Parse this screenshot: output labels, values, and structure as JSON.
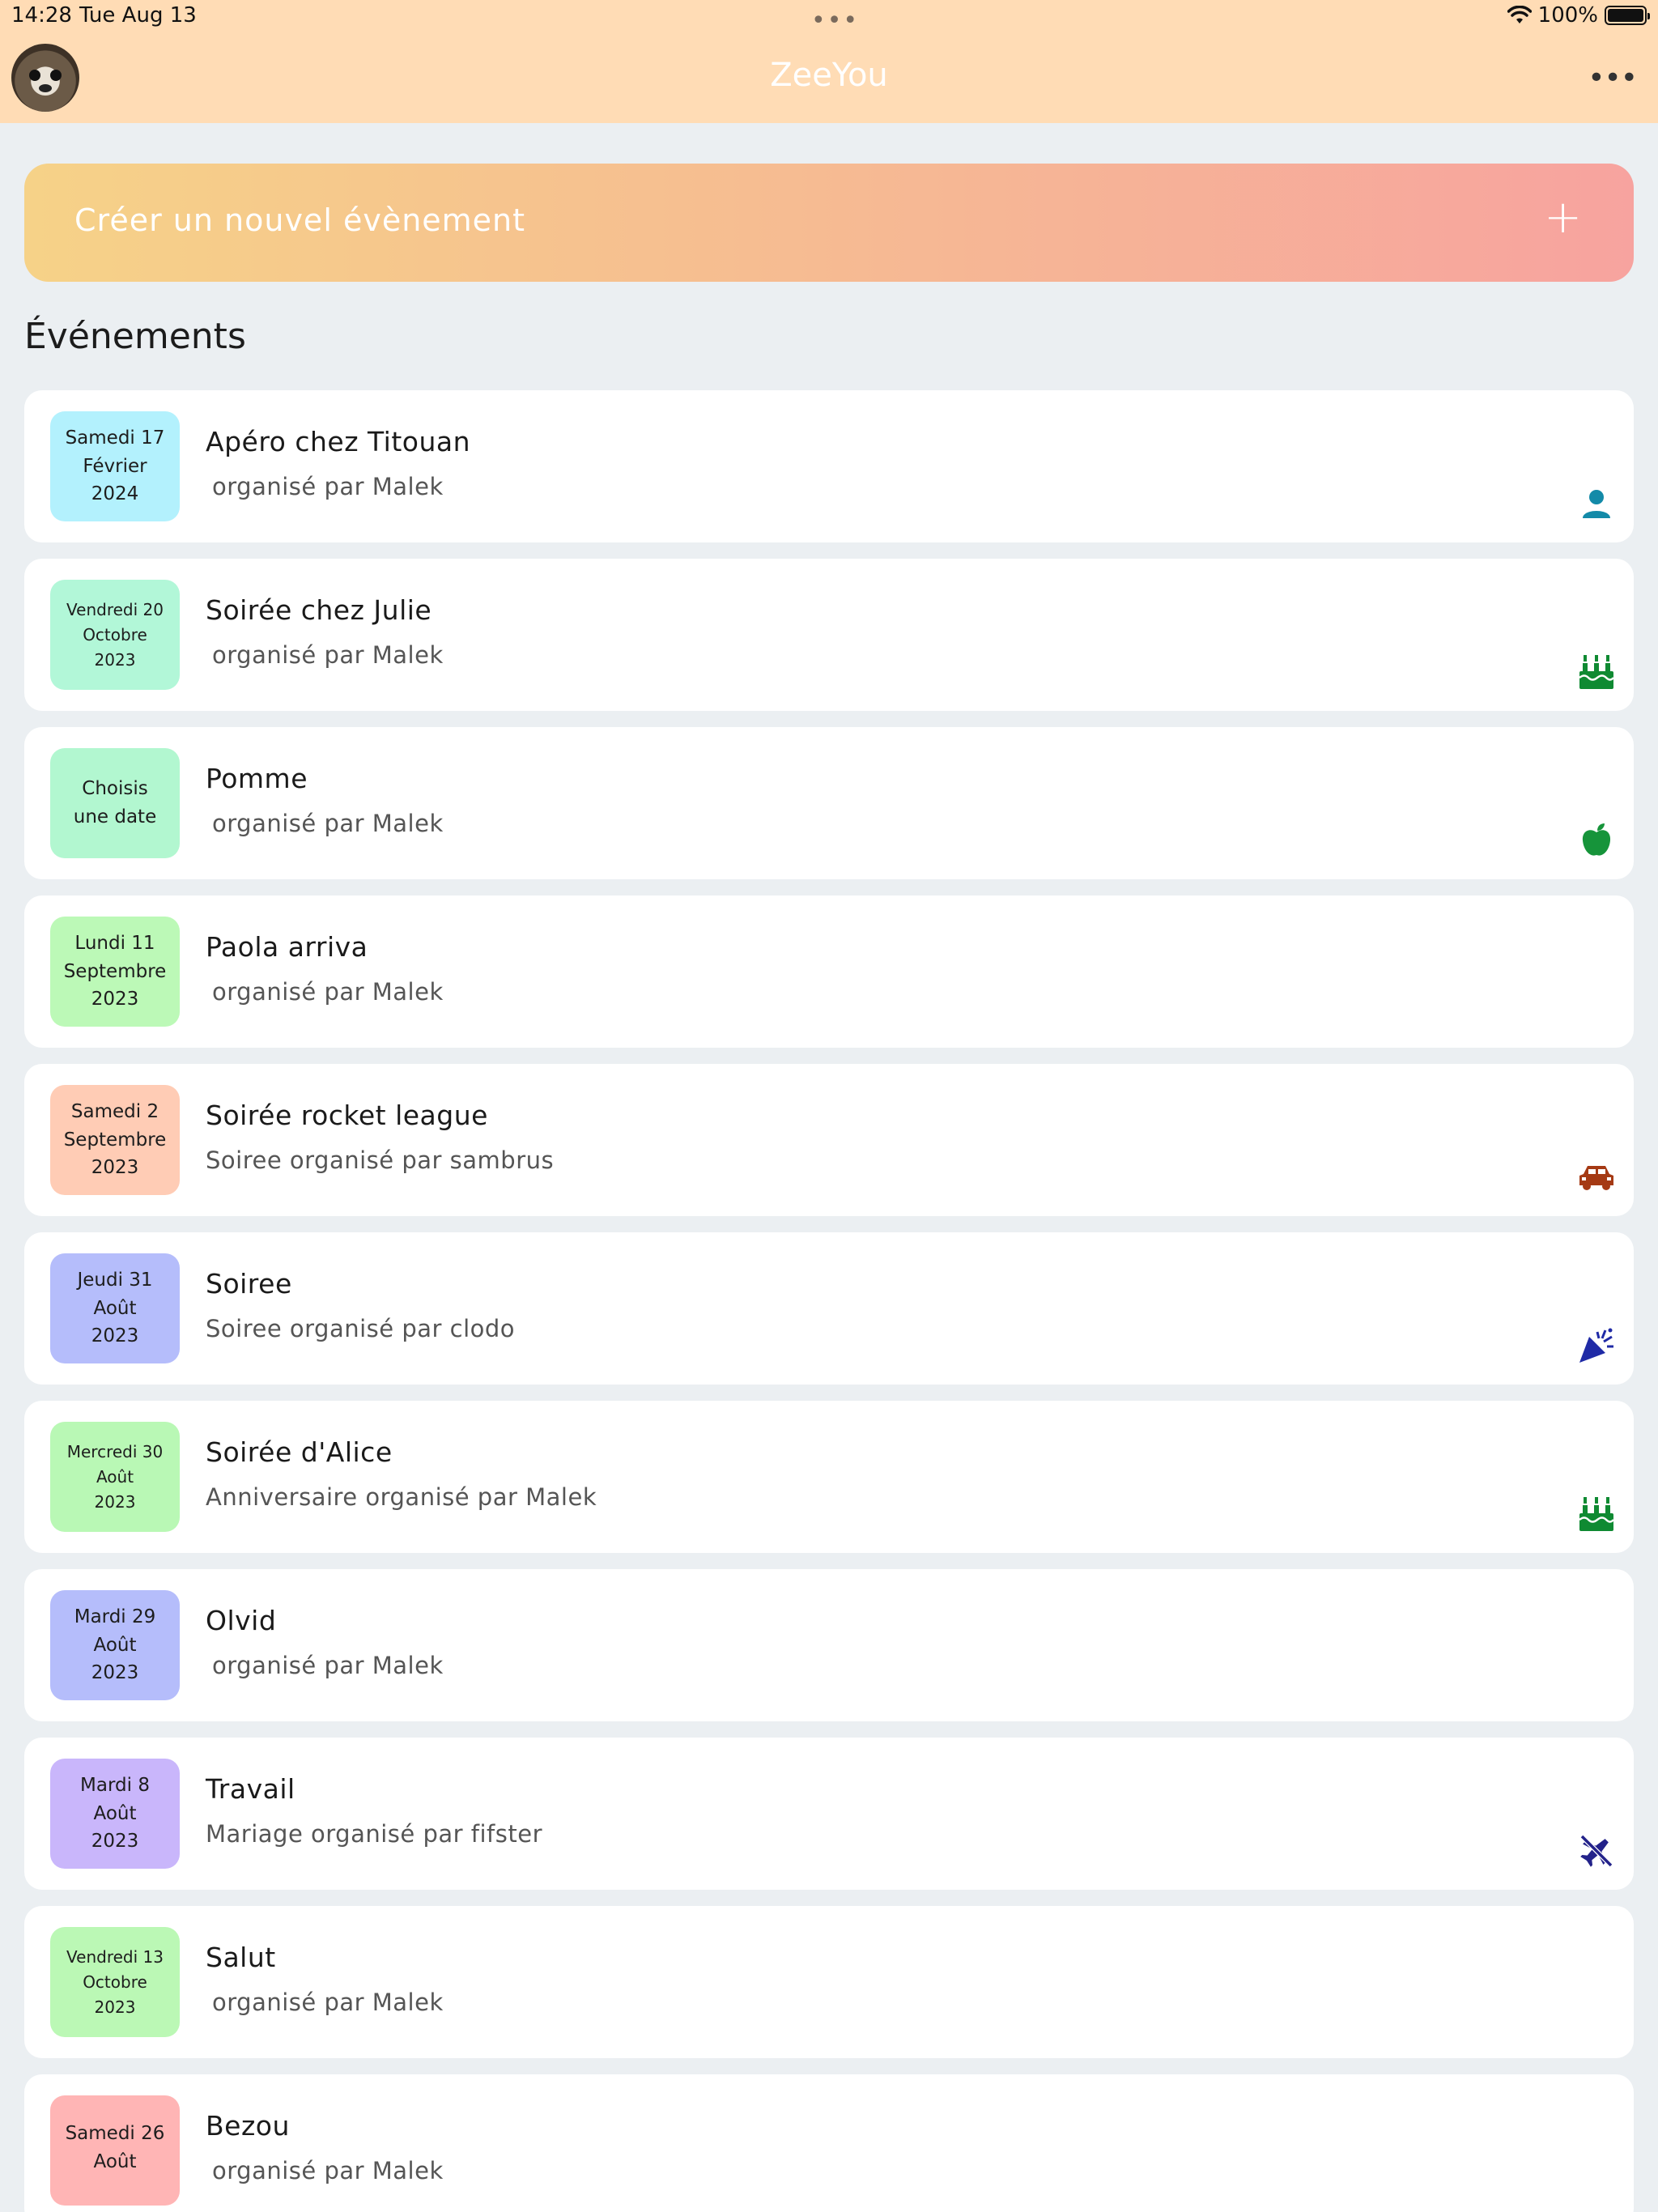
{
  "status_bar": {
    "time": "14:28",
    "date": "Tue Aug 13",
    "battery": "100%"
  },
  "header": {
    "title": "ZeeYou"
  },
  "create_button": {
    "label": "Créer un nouvel évènement",
    "icon": "+"
  },
  "section_title": "Événements",
  "events": [
    {
      "date_lines": [
        "Samedi 17",
        "Février",
        "2024"
      ],
      "date_color": "#b3f1fd",
      "title": "Apéro chez Titouan",
      "subtitle": "organisé par Malek",
      "icon": "person-icon",
      "icon_color": "#138aa8"
    },
    {
      "date_lines": [
        "Vendredi 20",
        "Octobre",
        "2023"
      ],
      "date_color": "#b2f7d8",
      "title": "Soirée chez Julie",
      "subtitle": "organisé par Malek",
      "icon": "cake-icon",
      "icon_color": "#0f8a32"
    },
    {
      "date_lines": [
        "Choisis",
        "une date"
      ],
      "date_color": "#b2f7d0",
      "title": "Pomme",
      "subtitle": "organisé par Malek",
      "icon": "apple-icon",
      "icon_color": "#16943a"
    },
    {
      "date_lines": [
        "Lundi 11",
        "Septembre",
        "2023"
      ],
      "date_color": "#bcf9b7",
      "title": "Paola arriva",
      "subtitle": "organisé par Malek",
      "icon": "",
      "icon_color": ""
    },
    {
      "date_lines": [
        "Samedi 2",
        "Septembre",
        "2023"
      ],
      "date_color": "#ffccb5",
      "title": "Soirée rocket league",
      "subtitle": "Soiree organisé par sambrus",
      "icon": "car-icon",
      "icon_color": "#a53a14"
    },
    {
      "date_lines": [
        "Jeudi 31",
        "Août",
        "2023"
      ],
      "date_color": "#b5bdfb",
      "title": "Soiree",
      "subtitle": "Soiree organisé par clodo",
      "icon": "party-popper-icon",
      "icon_color": "#1f2aa6"
    },
    {
      "date_lines": [
        "Mercredi 30",
        "Août",
        "2023"
      ],
      "date_color": "#b9f8b5",
      "title": "Soirée d'Alice",
      "subtitle": "Anniversaire organisé par Malek",
      "icon": "cake-icon",
      "icon_color": "#0f8a32"
    },
    {
      "date_lines": [
        "Mardi 29",
        "Août",
        "2023"
      ],
      "date_color": "#b5bdfb",
      "title": "Olvid",
      "subtitle": "organisé par Malek",
      "icon": "",
      "icon_color": ""
    },
    {
      "date_lines": [
        "Mardi 8",
        "Août",
        "2023"
      ],
      "date_color": "#c9b6fb",
      "title": "Travail",
      "subtitle": "Mariage organisé par fifster",
      "icon": "no-flight-icon",
      "icon_color": "#23228a"
    },
    {
      "date_lines": [
        "Vendredi 13",
        "Octobre",
        "2023"
      ],
      "date_color": "#bbf8b5",
      "title": "Salut",
      "subtitle": "organisé par Malek",
      "icon": "",
      "icon_color": ""
    },
    {
      "date_lines": [
        "Samedi 26",
        "Août",
        ""
      ],
      "date_color": "#ffb5b5",
      "title": "Bezou",
      "subtitle": "organisé par Malek",
      "icon": "",
      "icon_color": ""
    }
  ]
}
